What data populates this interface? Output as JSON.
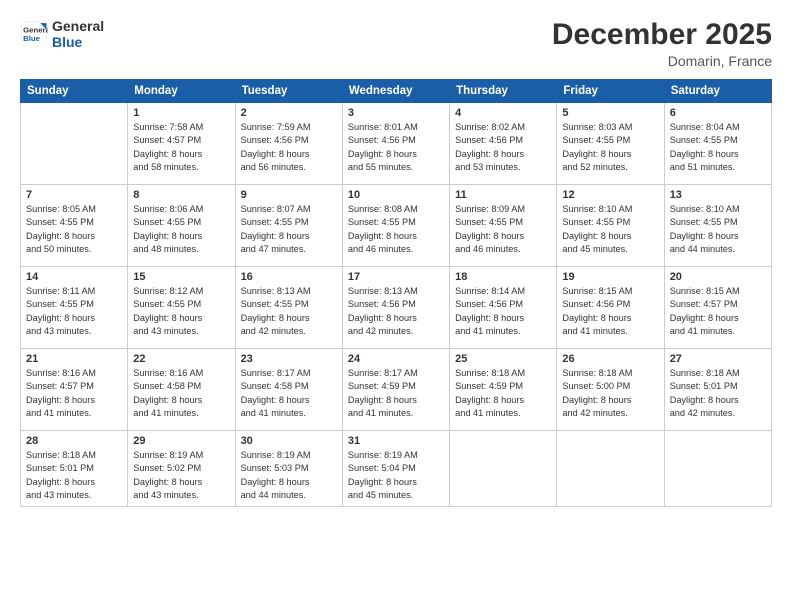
{
  "logo": {
    "line1": "General",
    "line2": "Blue"
  },
  "header": {
    "month": "December 2025",
    "location": "Domarin, France"
  },
  "weekdays": [
    "Sunday",
    "Monday",
    "Tuesday",
    "Wednesday",
    "Thursday",
    "Friday",
    "Saturday"
  ],
  "weeks": [
    [
      {
        "num": "",
        "info": ""
      },
      {
        "num": "1",
        "info": "Sunrise: 7:58 AM\nSunset: 4:57 PM\nDaylight: 8 hours\nand 58 minutes."
      },
      {
        "num": "2",
        "info": "Sunrise: 7:59 AM\nSunset: 4:56 PM\nDaylight: 8 hours\nand 56 minutes."
      },
      {
        "num": "3",
        "info": "Sunrise: 8:01 AM\nSunset: 4:56 PM\nDaylight: 8 hours\nand 55 minutes."
      },
      {
        "num": "4",
        "info": "Sunrise: 8:02 AM\nSunset: 4:56 PM\nDaylight: 8 hours\nand 53 minutes."
      },
      {
        "num": "5",
        "info": "Sunrise: 8:03 AM\nSunset: 4:55 PM\nDaylight: 8 hours\nand 52 minutes."
      },
      {
        "num": "6",
        "info": "Sunrise: 8:04 AM\nSunset: 4:55 PM\nDaylight: 8 hours\nand 51 minutes."
      }
    ],
    [
      {
        "num": "7",
        "info": "Sunrise: 8:05 AM\nSunset: 4:55 PM\nDaylight: 8 hours\nand 50 minutes."
      },
      {
        "num": "8",
        "info": "Sunrise: 8:06 AM\nSunset: 4:55 PM\nDaylight: 8 hours\nand 48 minutes."
      },
      {
        "num": "9",
        "info": "Sunrise: 8:07 AM\nSunset: 4:55 PM\nDaylight: 8 hours\nand 47 minutes."
      },
      {
        "num": "10",
        "info": "Sunrise: 8:08 AM\nSunset: 4:55 PM\nDaylight: 8 hours\nand 46 minutes."
      },
      {
        "num": "11",
        "info": "Sunrise: 8:09 AM\nSunset: 4:55 PM\nDaylight: 8 hours\nand 46 minutes."
      },
      {
        "num": "12",
        "info": "Sunrise: 8:10 AM\nSunset: 4:55 PM\nDaylight: 8 hours\nand 45 minutes."
      },
      {
        "num": "13",
        "info": "Sunrise: 8:10 AM\nSunset: 4:55 PM\nDaylight: 8 hours\nand 44 minutes."
      }
    ],
    [
      {
        "num": "14",
        "info": "Sunrise: 8:11 AM\nSunset: 4:55 PM\nDaylight: 8 hours\nand 43 minutes."
      },
      {
        "num": "15",
        "info": "Sunrise: 8:12 AM\nSunset: 4:55 PM\nDaylight: 8 hours\nand 43 minutes."
      },
      {
        "num": "16",
        "info": "Sunrise: 8:13 AM\nSunset: 4:55 PM\nDaylight: 8 hours\nand 42 minutes."
      },
      {
        "num": "17",
        "info": "Sunrise: 8:13 AM\nSunset: 4:56 PM\nDaylight: 8 hours\nand 42 minutes."
      },
      {
        "num": "18",
        "info": "Sunrise: 8:14 AM\nSunset: 4:56 PM\nDaylight: 8 hours\nand 41 minutes."
      },
      {
        "num": "19",
        "info": "Sunrise: 8:15 AM\nSunset: 4:56 PM\nDaylight: 8 hours\nand 41 minutes."
      },
      {
        "num": "20",
        "info": "Sunrise: 8:15 AM\nSunset: 4:57 PM\nDaylight: 8 hours\nand 41 minutes."
      }
    ],
    [
      {
        "num": "21",
        "info": "Sunrise: 8:16 AM\nSunset: 4:57 PM\nDaylight: 8 hours\nand 41 minutes."
      },
      {
        "num": "22",
        "info": "Sunrise: 8:16 AM\nSunset: 4:58 PM\nDaylight: 8 hours\nand 41 minutes."
      },
      {
        "num": "23",
        "info": "Sunrise: 8:17 AM\nSunset: 4:58 PM\nDaylight: 8 hours\nand 41 minutes."
      },
      {
        "num": "24",
        "info": "Sunrise: 8:17 AM\nSunset: 4:59 PM\nDaylight: 8 hours\nand 41 minutes."
      },
      {
        "num": "25",
        "info": "Sunrise: 8:18 AM\nSunset: 4:59 PM\nDaylight: 8 hours\nand 41 minutes."
      },
      {
        "num": "26",
        "info": "Sunrise: 8:18 AM\nSunset: 5:00 PM\nDaylight: 8 hours\nand 42 minutes."
      },
      {
        "num": "27",
        "info": "Sunrise: 8:18 AM\nSunset: 5:01 PM\nDaylight: 8 hours\nand 42 minutes."
      }
    ],
    [
      {
        "num": "28",
        "info": "Sunrise: 8:18 AM\nSunset: 5:01 PM\nDaylight: 8 hours\nand 43 minutes."
      },
      {
        "num": "29",
        "info": "Sunrise: 8:19 AM\nSunset: 5:02 PM\nDaylight: 8 hours\nand 43 minutes."
      },
      {
        "num": "30",
        "info": "Sunrise: 8:19 AM\nSunset: 5:03 PM\nDaylight: 8 hours\nand 44 minutes."
      },
      {
        "num": "31",
        "info": "Sunrise: 8:19 AM\nSunset: 5:04 PM\nDaylight: 8 hours\nand 45 minutes."
      },
      {
        "num": "",
        "info": ""
      },
      {
        "num": "",
        "info": ""
      },
      {
        "num": "",
        "info": ""
      }
    ]
  ]
}
